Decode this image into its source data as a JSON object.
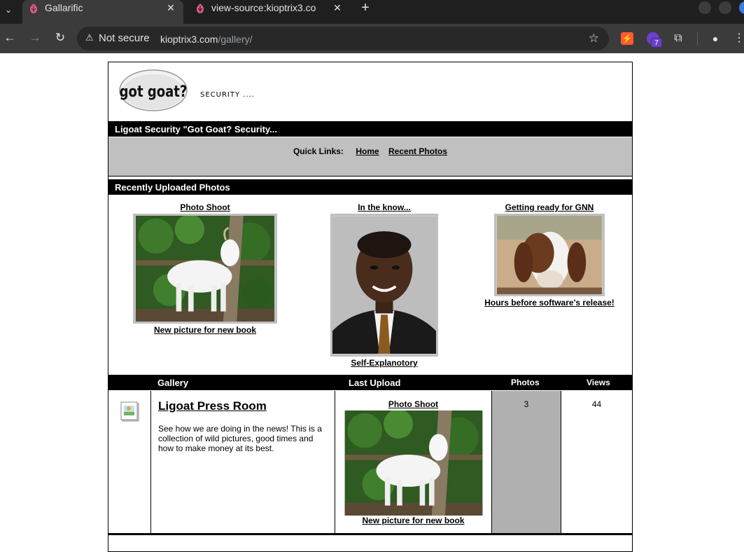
{
  "browser": {
    "tabs": [
      {
        "title": "Gallarific",
        "active": true
      },
      {
        "title": "view-source:kioptrix3.co",
        "active": false
      }
    ],
    "new_tab_symbol": "+",
    "security_label": "Not secure",
    "url_host": "kioptrix3.com",
    "url_path": "/gallery/",
    "extension_badge": "7",
    "colors": {
      "chrome_dark": "#1f1f1f",
      "toolbar": "#3b3b3b",
      "omnibox": "#282828"
    }
  },
  "site": {
    "logo_text": "got goat?",
    "slogan": "SECURITY ....",
    "header_bar": "Ligoat Security \"Got Goat? Security...",
    "quick_links_label": "Quick Links:",
    "quick_links": [
      "Home",
      "Recent Photos"
    ],
    "recent_bar": "Recently Uploaded Photos",
    "recent": [
      {
        "title": "Photo Shoot",
        "caption": "New picture for new book"
      },
      {
        "title": "In the know...",
        "caption": "Self-Explanotory"
      },
      {
        "title": "Getting ready for GNN",
        "caption": "Hours before software's release!"
      }
    ],
    "gallery_table": {
      "headers": {
        "gallery": "Gallery",
        "last_upload": "Last Upload",
        "photos": "Photos",
        "views": "Views"
      },
      "row": {
        "name": "Ligoat Press Room",
        "description": "See how we are doing in the news! This is a collection of wild pictures, good times and how to make money at its best.",
        "last_title": "Photo Shoot",
        "last_caption": "New picture for new book",
        "photos": "3",
        "views": "44"
      }
    }
  }
}
